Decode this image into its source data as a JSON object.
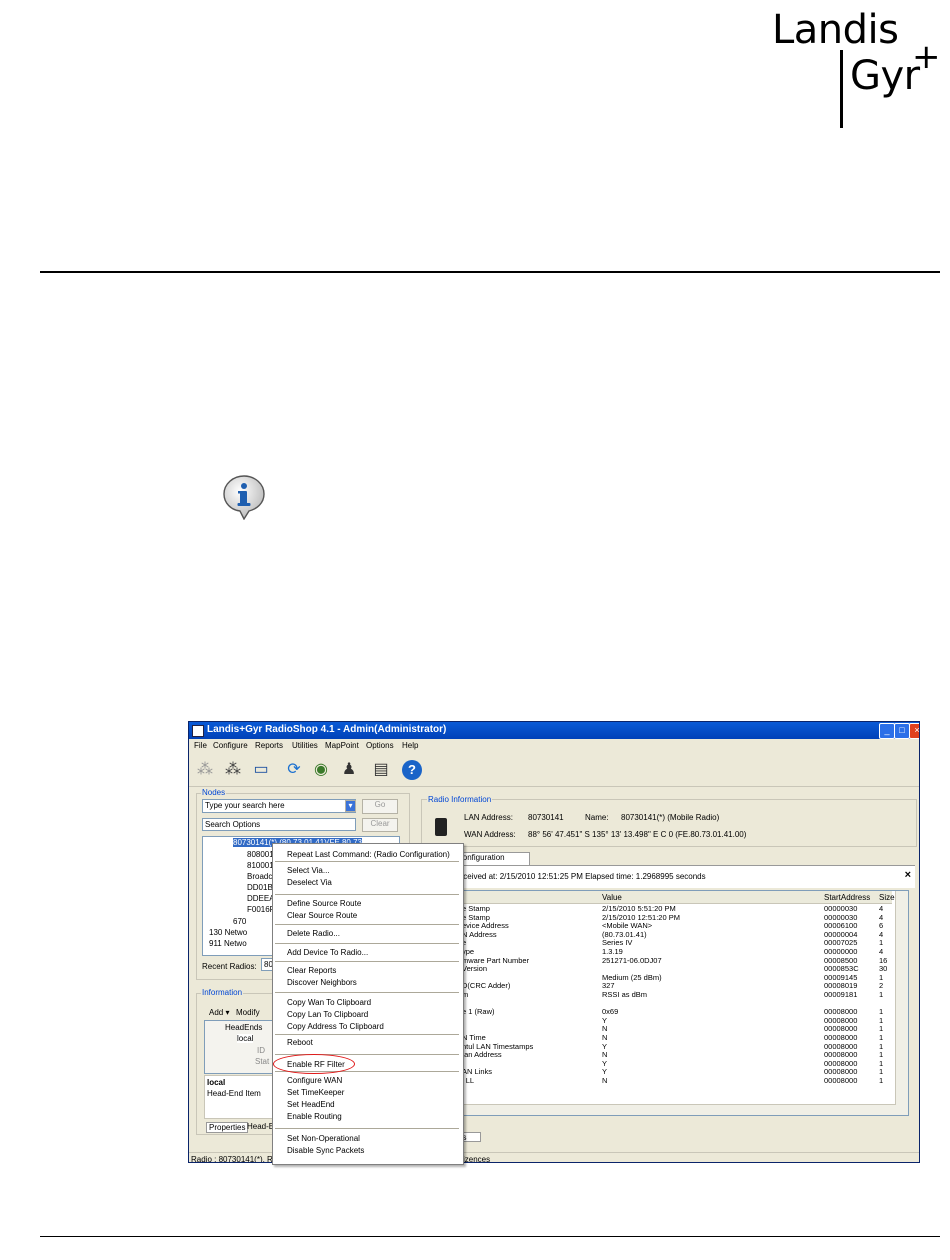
{
  "logo": {
    "line1": "Landis",
    "line2": "Gyr",
    "plus": "+"
  },
  "colors": {
    "accent": "#0046d5",
    "highlight_ellipse": "#e01818",
    "titlebar": "#0a5ad6"
  },
  "icons": {
    "note": "info-icon"
  },
  "app": {
    "title": "Landis+Gyr RadioShop 4.1 - Admin(Administrator)",
    "menu": [
      "File",
      "Configure",
      "Reports",
      "Utilities",
      "MapPoint",
      "Options",
      "Help"
    ],
    "nodes_label": "Nodes",
    "search_placeholder": "Type your search here",
    "go_label": "Go",
    "search_options": "Search Options",
    "clear_label": "Clear",
    "tree_items": [
      "80730141(*) (80.73.01.41)(FE.80.73",
      "8080014",
      "8100014",
      "Broadca",
      "DD01B6",
      "DDEEA",
      "F0016F",
      "670",
      "130 Netwo",
      "911 Netwo"
    ],
    "recent_radios_label": "Recent Radios:",
    "recent_radios_value": "80",
    "information_label": "Information",
    "add_label": "Add ▾",
    "modify_label": "Modify",
    "info_tree": [
      "HeadEnds",
      "local",
      "ID",
      "Stat"
    ],
    "local_title": "local",
    "local_desc": "Head-End Item",
    "bottom_tabs": [
      "Properties",
      "Head-E"
    ],
    "radio_info_label": "Radio Information",
    "lan_address_label": "LAN Address:",
    "lan_address": "80730141",
    "name_label": "Name:",
    "name_value": "80730141(*) (Mobile Radio)",
    "wan_address_label": "WAN Address:",
    "wan_address": "88° 56' 47.451\"  S 135° 13' 13.498\"  E C 0 (FE.80.73.01.41.00)",
    "config_tab": "Configuration",
    "received_text": "Received at: 2/15/2010 12:51:25 PM Elapsed time: 1.2968995 seconds",
    "table_headers": [
      "Value",
      "StartAddress",
      "Size"
    ],
    "table_rows": [
      [
        "e Stamp",
        "2/15/2010 5:51:20 PM",
        "00000030",
        "4"
      ],
      [
        "e Stamp",
        "2/15/2010 12:51:20 PM",
        "00000030",
        "4"
      ],
      [
        "evice Address",
        "<Mobile WAN>",
        "00006100",
        "6"
      ],
      [
        "N Address",
        "(80.73.01.41)",
        "00000004",
        "4"
      ],
      [
        "e",
        "Series IV",
        "00007025",
        "1"
      ],
      [
        "ype",
        "1.3.19",
        "00000000",
        "4"
      ],
      [
        "mware Part Number",
        "251271-06.0DJ07",
        "00008500",
        "16"
      ],
      [
        "Version",
        "",
        "0000853C",
        "30"
      ],
      [
        "",
        "Medium (25 dBm)",
        "00009145",
        "1"
      ],
      [
        "D(CRC Adder)",
        "327",
        "00008019",
        "2"
      ],
      [
        "m",
        "RSSI as dBm",
        "00009181",
        "1"
      ],
      [
        "",
        "",
        "",
        ""
      ],
      [
        "e 1 (Raw)",
        "0x69",
        "00008000",
        "1"
      ],
      [
        "l",
        "Y",
        "00008000",
        "1"
      ],
      [
        "",
        "N",
        "00008000",
        "1"
      ],
      [
        "N Time",
        "N",
        "00008000",
        "1"
      ],
      [
        "ntul LAN Timestamps",
        "Y",
        "00008000",
        "1"
      ],
      [
        "/an Address",
        "N",
        "00008000",
        "1"
      ],
      [
        "",
        "Y",
        "00008000",
        "1"
      ],
      [
        "AN Links",
        "Y",
        "00008000",
        "1"
      ],
      [
        "l LL",
        "N",
        "00008000",
        "1"
      ]
    ],
    "bottom_tab_right": "ults",
    "status_left": "Radio : 80730141(*), Re",
    "status_right": "lelizences"
  },
  "context_menu": {
    "items": [
      "Repeat Last Command: (Radio Configuration)",
      "Select Via...",
      "Deselect Via",
      "Define Source Route",
      "Clear Source Route",
      "Delete Radio...",
      "Add Device To Radio...",
      "Clear Reports",
      "Discover Neighbors",
      "Copy Wan To Clipboard",
      "Copy Lan To Clipboard",
      "Copy Address To Clipboard",
      "Reboot",
      "Enable RF Filter",
      "Configure WAN",
      "Set TimeKeeper",
      "Set HeadEnd",
      "Enable Routing",
      "Set Non-Operational",
      "Disable Sync Packets"
    ]
  }
}
